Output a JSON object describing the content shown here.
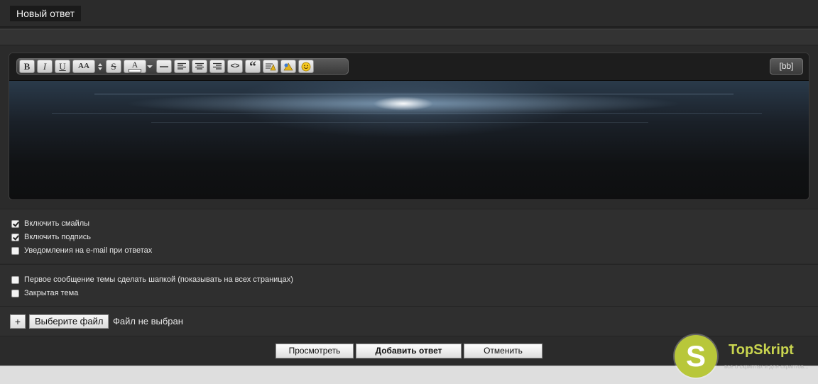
{
  "header": {
    "title": "Новый ответ"
  },
  "editor": {
    "toolbar": {
      "bold": "B",
      "italic": "I",
      "underline": "U",
      "font_size": "AA",
      "strike": "S",
      "color": "A",
      "code": "<>",
      "quote": "“"
    },
    "source_toggle": "[bb]",
    "icons": [
      "bold-icon",
      "italic-icon",
      "underline-icon",
      "font-size-icon",
      "strike-icon",
      "text-color-icon",
      "horizontal-rule-icon",
      "align-left-icon",
      "align-center-icon",
      "align-right-icon",
      "code-icon",
      "quote-icon",
      "spoiler-icon",
      "hide-icon",
      "smiley-icon"
    ]
  },
  "options": {
    "group1": [
      {
        "label": "Включить смайлы",
        "checked": true
      },
      {
        "label": "Включить подпись",
        "checked": true
      },
      {
        "label": "Уведомления на e-mail при ответах",
        "checked": false
      }
    ],
    "group2": [
      {
        "label": "Первое сообщение темы сделать шапкой (показывать на всех страницах)",
        "checked": false
      },
      {
        "label": "Закрытая тема",
        "checked": false
      }
    ]
  },
  "attachment": {
    "add_label": "+",
    "choose_label": "Выберите файл",
    "status": "Файл не выбран"
  },
  "actions": {
    "preview": "Просмотреть",
    "submit": "Добавить ответ",
    "cancel": "Отменить"
  },
  "watermark": {
    "letter": "S",
    "name": "TopSkript",
    "tagline": "все о скриптах и для скриптов..."
  },
  "colors": {
    "background": "#2b2b2b",
    "panel": "#2f2f2f",
    "accent": "#b8c73a"
  }
}
